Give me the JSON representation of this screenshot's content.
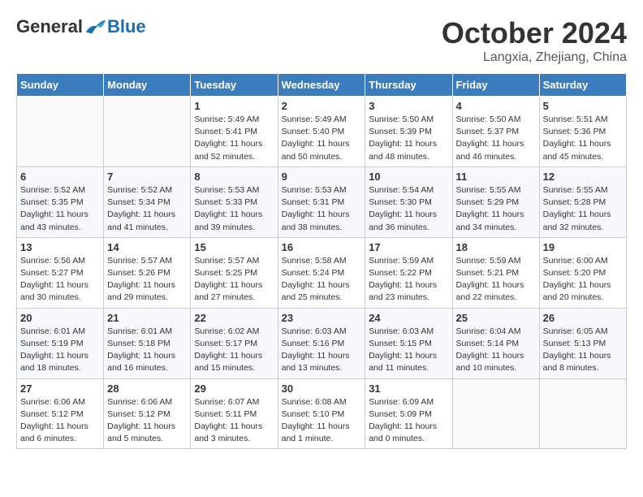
{
  "header": {
    "logo_general": "General",
    "logo_blue": "Blue",
    "month_title": "October 2024",
    "location": "Langxia, Zhejiang, China"
  },
  "weekdays": [
    "Sunday",
    "Monday",
    "Tuesday",
    "Wednesday",
    "Thursday",
    "Friday",
    "Saturday"
  ],
  "weeks": [
    [
      {
        "day": "",
        "sunrise": "",
        "sunset": "",
        "daylight": ""
      },
      {
        "day": "",
        "sunrise": "",
        "sunset": "",
        "daylight": ""
      },
      {
        "day": "1",
        "sunrise": "Sunrise: 5:49 AM",
        "sunset": "Sunset: 5:41 PM",
        "daylight": "Daylight: 11 hours and 52 minutes."
      },
      {
        "day": "2",
        "sunrise": "Sunrise: 5:49 AM",
        "sunset": "Sunset: 5:40 PM",
        "daylight": "Daylight: 11 hours and 50 minutes."
      },
      {
        "day": "3",
        "sunrise": "Sunrise: 5:50 AM",
        "sunset": "Sunset: 5:39 PM",
        "daylight": "Daylight: 11 hours and 48 minutes."
      },
      {
        "day": "4",
        "sunrise": "Sunrise: 5:50 AM",
        "sunset": "Sunset: 5:37 PM",
        "daylight": "Daylight: 11 hours and 46 minutes."
      },
      {
        "day": "5",
        "sunrise": "Sunrise: 5:51 AM",
        "sunset": "Sunset: 5:36 PM",
        "daylight": "Daylight: 11 hours and 45 minutes."
      }
    ],
    [
      {
        "day": "6",
        "sunrise": "Sunrise: 5:52 AM",
        "sunset": "Sunset: 5:35 PM",
        "daylight": "Daylight: 11 hours and 43 minutes."
      },
      {
        "day": "7",
        "sunrise": "Sunrise: 5:52 AM",
        "sunset": "Sunset: 5:34 PM",
        "daylight": "Daylight: 11 hours and 41 minutes."
      },
      {
        "day": "8",
        "sunrise": "Sunrise: 5:53 AM",
        "sunset": "Sunset: 5:33 PM",
        "daylight": "Daylight: 11 hours and 39 minutes."
      },
      {
        "day": "9",
        "sunrise": "Sunrise: 5:53 AM",
        "sunset": "Sunset: 5:31 PM",
        "daylight": "Daylight: 11 hours and 38 minutes."
      },
      {
        "day": "10",
        "sunrise": "Sunrise: 5:54 AM",
        "sunset": "Sunset: 5:30 PM",
        "daylight": "Daylight: 11 hours and 36 minutes."
      },
      {
        "day": "11",
        "sunrise": "Sunrise: 5:55 AM",
        "sunset": "Sunset: 5:29 PM",
        "daylight": "Daylight: 11 hours and 34 minutes."
      },
      {
        "day": "12",
        "sunrise": "Sunrise: 5:55 AM",
        "sunset": "Sunset: 5:28 PM",
        "daylight": "Daylight: 11 hours and 32 minutes."
      }
    ],
    [
      {
        "day": "13",
        "sunrise": "Sunrise: 5:56 AM",
        "sunset": "Sunset: 5:27 PM",
        "daylight": "Daylight: 11 hours and 30 minutes."
      },
      {
        "day": "14",
        "sunrise": "Sunrise: 5:57 AM",
        "sunset": "Sunset: 5:26 PM",
        "daylight": "Daylight: 11 hours and 29 minutes."
      },
      {
        "day": "15",
        "sunrise": "Sunrise: 5:57 AM",
        "sunset": "Sunset: 5:25 PM",
        "daylight": "Daylight: 11 hours and 27 minutes."
      },
      {
        "day": "16",
        "sunrise": "Sunrise: 5:58 AM",
        "sunset": "Sunset: 5:24 PM",
        "daylight": "Daylight: 11 hours and 25 minutes."
      },
      {
        "day": "17",
        "sunrise": "Sunrise: 5:59 AM",
        "sunset": "Sunset: 5:22 PM",
        "daylight": "Daylight: 11 hours and 23 minutes."
      },
      {
        "day": "18",
        "sunrise": "Sunrise: 5:59 AM",
        "sunset": "Sunset: 5:21 PM",
        "daylight": "Daylight: 11 hours and 22 minutes."
      },
      {
        "day": "19",
        "sunrise": "Sunrise: 6:00 AM",
        "sunset": "Sunset: 5:20 PM",
        "daylight": "Daylight: 11 hours and 20 minutes."
      }
    ],
    [
      {
        "day": "20",
        "sunrise": "Sunrise: 6:01 AM",
        "sunset": "Sunset: 5:19 PM",
        "daylight": "Daylight: 11 hours and 18 minutes."
      },
      {
        "day": "21",
        "sunrise": "Sunrise: 6:01 AM",
        "sunset": "Sunset: 5:18 PM",
        "daylight": "Daylight: 11 hours and 16 minutes."
      },
      {
        "day": "22",
        "sunrise": "Sunrise: 6:02 AM",
        "sunset": "Sunset: 5:17 PM",
        "daylight": "Daylight: 11 hours and 15 minutes."
      },
      {
        "day": "23",
        "sunrise": "Sunrise: 6:03 AM",
        "sunset": "Sunset: 5:16 PM",
        "daylight": "Daylight: 11 hours and 13 minutes."
      },
      {
        "day": "24",
        "sunrise": "Sunrise: 6:03 AM",
        "sunset": "Sunset: 5:15 PM",
        "daylight": "Daylight: 11 hours and 11 minutes."
      },
      {
        "day": "25",
        "sunrise": "Sunrise: 6:04 AM",
        "sunset": "Sunset: 5:14 PM",
        "daylight": "Daylight: 11 hours and 10 minutes."
      },
      {
        "day": "26",
        "sunrise": "Sunrise: 6:05 AM",
        "sunset": "Sunset: 5:13 PM",
        "daylight": "Daylight: 11 hours and 8 minutes."
      }
    ],
    [
      {
        "day": "27",
        "sunrise": "Sunrise: 6:06 AM",
        "sunset": "Sunset: 5:12 PM",
        "daylight": "Daylight: 11 hours and 6 minutes."
      },
      {
        "day": "28",
        "sunrise": "Sunrise: 6:06 AM",
        "sunset": "Sunset: 5:12 PM",
        "daylight": "Daylight: 11 hours and 5 minutes."
      },
      {
        "day": "29",
        "sunrise": "Sunrise: 6:07 AM",
        "sunset": "Sunset: 5:11 PM",
        "daylight": "Daylight: 11 hours and 3 minutes."
      },
      {
        "day": "30",
        "sunrise": "Sunrise: 6:08 AM",
        "sunset": "Sunset: 5:10 PM",
        "daylight": "Daylight: 11 hours and 1 minute."
      },
      {
        "day": "31",
        "sunrise": "Sunrise: 6:09 AM",
        "sunset": "Sunset: 5:09 PM",
        "daylight": "Daylight: 11 hours and 0 minutes."
      },
      {
        "day": "",
        "sunrise": "",
        "sunset": "",
        "daylight": ""
      },
      {
        "day": "",
        "sunrise": "",
        "sunset": "",
        "daylight": ""
      }
    ]
  ]
}
